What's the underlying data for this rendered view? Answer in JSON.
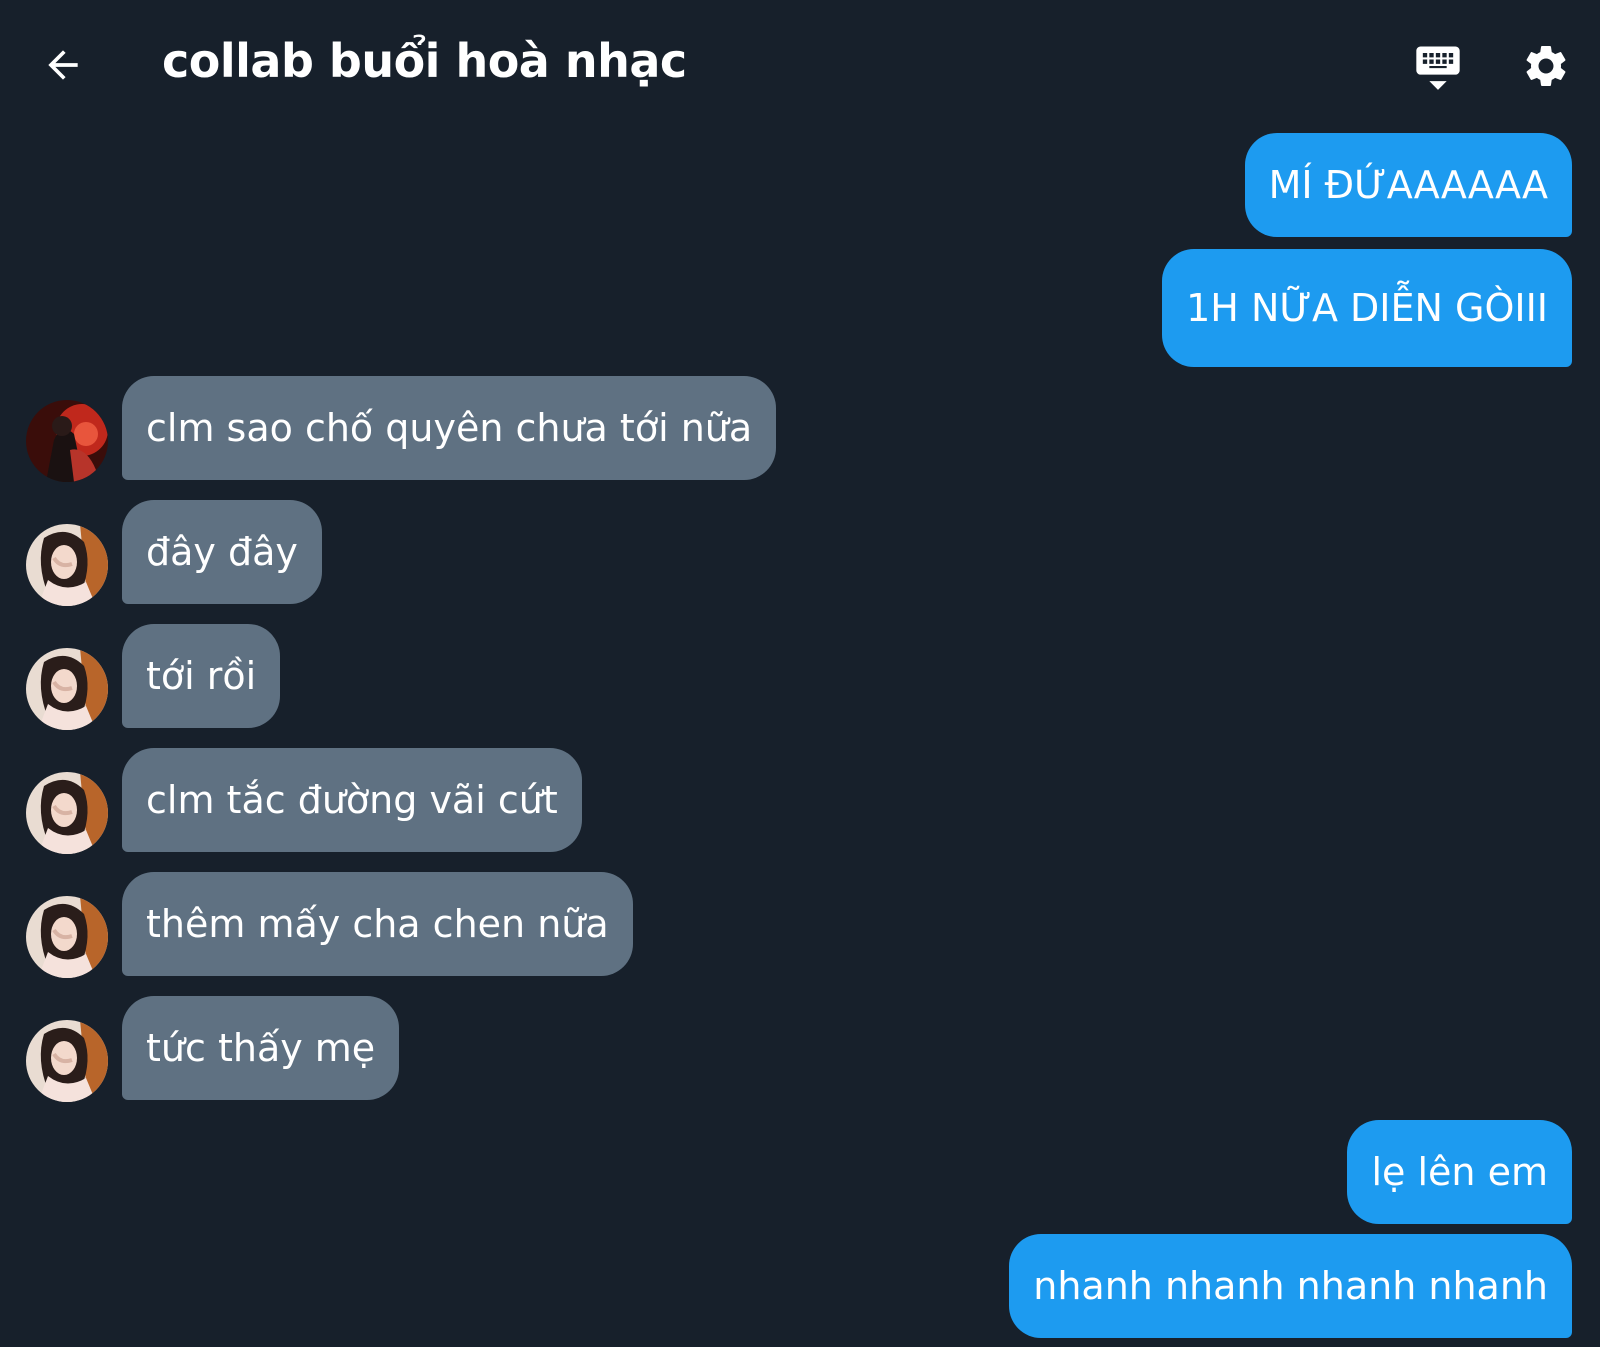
{
  "header": {
    "title": "collab buổi hoà nhạc",
    "back_icon": "arrow-left-icon",
    "keyboard_icon": "keyboard-hide-icon",
    "settings_icon": "gear-icon"
  },
  "colors": {
    "background": "#17202b",
    "outgoing_bubble": "#1d9bf0",
    "incoming_bubble": "#5f7182",
    "text": "#ffffff"
  },
  "messages": [
    {
      "direction": "outgoing",
      "text": "MÍ ĐỨAAAAAA"
    },
    {
      "direction": "outgoing",
      "text": "1H NỮA DIỄN GÒIII"
    },
    {
      "direction": "incoming",
      "sender_avatar": "avatar-red",
      "text": "clm sao chố quyên chưa tới nữa"
    },
    {
      "direction": "incoming",
      "sender_avatar": "avatar-girl",
      "text": "đây đây"
    },
    {
      "direction": "incoming",
      "sender_avatar": "avatar-girl",
      "text": "tới rồi"
    },
    {
      "direction": "incoming",
      "sender_avatar": "avatar-girl",
      "text": "clm tắc đường vãi cứt"
    },
    {
      "direction": "incoming",
      "sender_avatar": "avatar-girl",
      "text": "thêm mấy cha chen nữa"
    },
    {
      "direction": "incoming",
      "sender_avatar": "avatar-girl",
      "text": "tức thấy mẹ"
    },
    {
      "direction": "outgoing",
      "text": "lẹ lên em"
    },
    {
      "direction": "outgoing",
      "text": "nhanh nhanh nhanh nhanh"
    }
  ]
}
